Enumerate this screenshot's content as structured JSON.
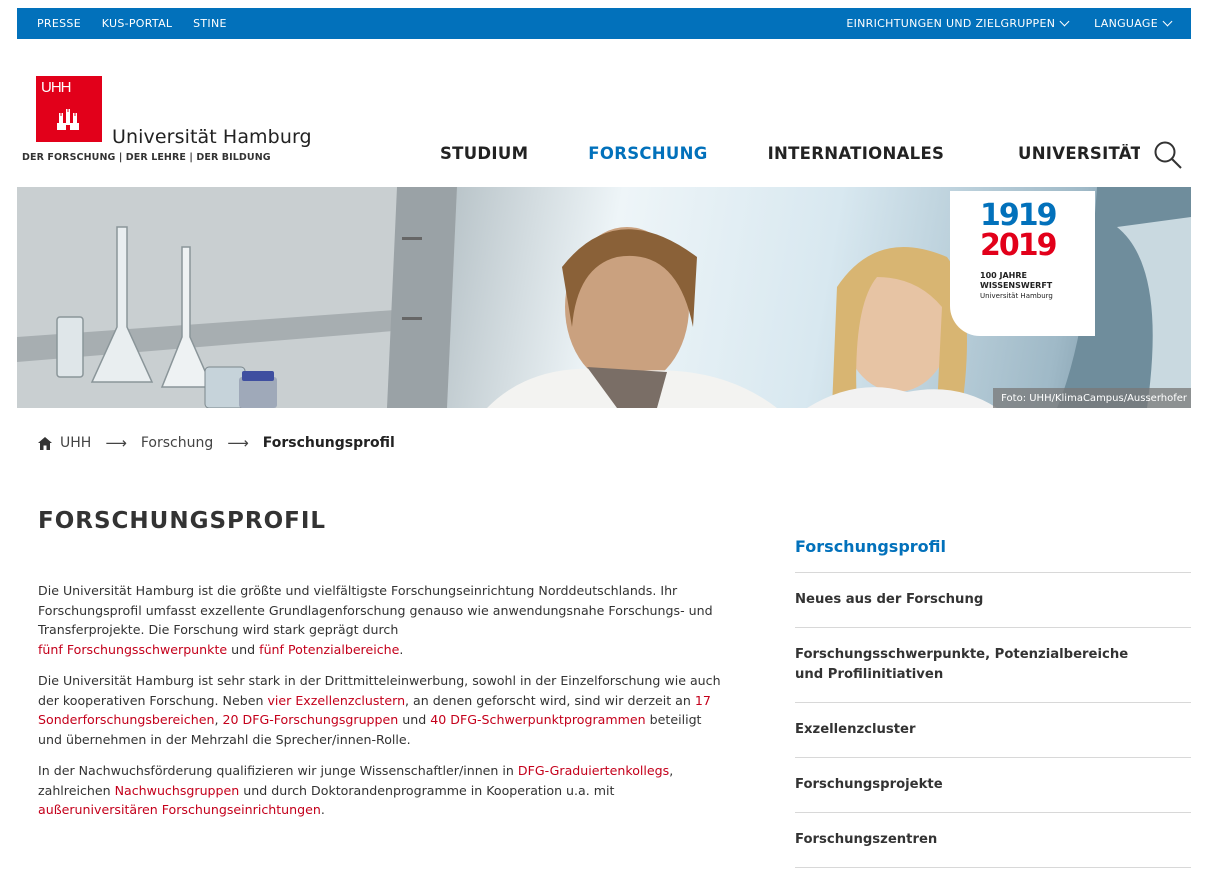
{
  "topbar": {
    "left": [
      "PRESSE",
      "KUS-PORTAL",
      "STINE"
    ],
    "right": [
      {
        "label": "EINRICHTUNGEN UND ZIELGRUPPEN"
      },
      {
        "label": "LANGUAGE"
      }
    ]
  },
  "logo": {
    "mark": "UHH",
    "name": "Universität Hamburg",
    "tagline": "DER FORSCHUNG | DER LEHRE | DER BILDUNG"
  },
  "mainnav": {
    "items": [
      "STUDIUM",
      "FORSCHUNG",
      "INTERNATIONALES",
      "UNIVERSITÄT"
    ],
    "active": "FORSCHUNG"
  },
  "hero": {
    "badge": {
      "year1": "1919",
      "year2": "2019",
      "line1": "100 JAHRE",
      "line2": "WISSENSWERFT",
      "line3": "Universität Hamburg"
    },
    "credit": "Foto: UHH/KlimaCampus/Ausserhofer"
  },
  "breadcrumb": {
    "home": "UHH",
    "level1": "Forschung",
    "current": "Forschungsprofil",
    "separator": "⟶"
  },
  "main": {
    "title": "FORSCHUNGSPROFIL",
    "p1": {
      "text": "Die Universität Hamburg ist die größte und vielfältigste Forschungseinrichtung Norddeutschlands. Ihr Forschungsprofil umfasst exzellente Grundlagenforschung genauso wie anwendungsnahe Forschungs- und Transferprojekte. Die Forschung wird stark geprägt durch",
      "link1": "fünf Forschungsschwerpunkte",
      "mid": "und",
      "link2": "fünf Potenzialbereiche",
      "end": "."
    },
    "p2": {
      "t1": "Die Universität Hamburg ist sehr stark in der Drittmitteleinwerbung, sowohl in der Einzelforschung wie auch der kooperativen Forschung. Neben",
      "l1": "vier Exzellenzclustern",
      "t2": ", an denen geforscht wird, sind wir derzeit an",
      "l2": "17 Sonderforschungsbereichen",
      "t3": ",",
      "l3": "20 DFG-Forschungsgruppen",
      "t4": "und",
      "l4": "40 DFG-Schwerpunktprogrammen",
      "t5": "beteiligt und übernehmen in der Mehrzahl die Sprecher/innen-Rolle."
    },
    "p3": {
      "t1": "In der Nachwuchsförderung qualifizieren wir junge Wissenschaftler/innen in",
      "l1": "DFG-Graduiertenkollegs",
      "t2": ", zahlreichen",
      "l2": "Nachwuchsgruppen",
      "t3": "und durch Doktorandenprogramme in Kooperation u.a. mit",
      "l3": "außeruniversitären Forschungseinrichtungen",
      "t4": "."
    }
  },
  "sidebar": {
    "title": "Forschungsprofil",
    "items": [
      "Neues aus der Forschung",
      "Forschungsschwerpunkte, Potenzialbereiche und Profilinitiativen",
      "Exzellenzcluster",
      "Forschungsprojekte",
      "Forschungszentren"
    ]
  },
  "colors": {
    "primary_blue": "#0271bb",
    "brand_red": "#e2001a",
    "link_red": "#c4001b"
  }
}
